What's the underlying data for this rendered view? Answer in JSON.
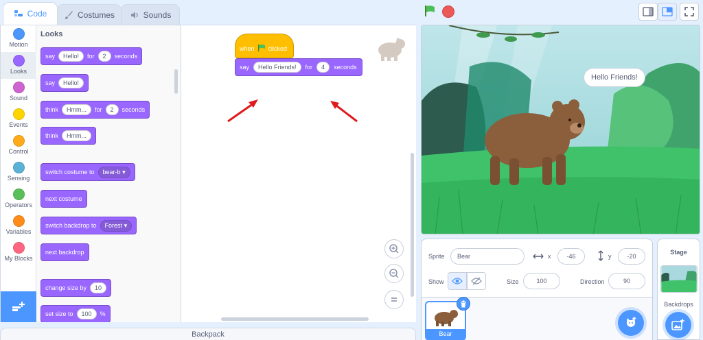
{
  "tabs": {
    "code": "Code",
    "costumes": "Costumes",
    "sounds": "Sounds"
  },
  "categories": [
    {
      "label": "Motion",
      "color": "#4c97ff"
    },
    {
      "label": "Looks",
      "color": "#9966ff"
    },
    {
      "label": "Sound",
      "color": "#cf63cf"
    },
    {
      "label": "Events",
      "color": "#ffd500"
    },
    {
      "label": "Control",
      "color": "#ffab19"
    },
    {
      "label": "Sensing",
      "color": "#5cb1d6"
    },
    {
      "label": "Operators",
      "color": "#59c059"
    },
    {
      "label": "Variables",
      "color": "#ff8c1a"
    },
    {
      "label": "My Blocks",
      "color": "#ff6680"
    }
  ],
  "palette": {
    "title": "Looks",
    "say_for": {
      "say": "say",
      "msg": "Hello!",
      "for": "for",
      "secs": "2",
      "seconds": "seconds"
    },
    "say": {
      "say": "say",
      "msg": "Hello!"
    },
    "think_for": {
      "think": "think",
      "msg": "Hmm...",
      "for": "for",
      "secs": "2",
      "seconds": "seconds"
    },
    "think": {
      "think": "think",
      "msg": "Hmm..."
    },
    "switch_costume": {
      "label": "switch costume to",
      "value": "bear-b"
    },
    "next_costume": "next costume",
    "switch_backdrop": {
      "label": "switch backdrop to",
      "value": "Forest"
    },
    "next_backdrop": "next backdrop",
    "change_size": {
      "label": "change size by",
      "value": "10"
    },
    "set_size": {
      "label": "set size to",
      "value": "100",
      "unit": "%"
    }
  },
  "script": {
    "hat": {
      "when": "when",
      "clicked": "clicked"
    },
    "say": {
      "say": "say",
      "msg": "Hello Friends!",
      "for": "for",
      "secs": "4",
      "seconds": "seconds"
    }
  },
  "backpack": "Backpack",
  "stage": {
    "bubble": "Hello Friends!"
  },
  "sprite_info": {
    "sprite_label": "Sprite",
    "sprite_name": "Bear",
    "x_label": "x",
    "x": "-46",
    "y_label": "y",
    "y": "-20",
    "show_label": "Show",
    "size_label": "Size",
    "size": "100",
    "direction_label": "Direction",
    "direction": "90",
    "thumb_name": "Bear"
  },
  "stage_panel": {
    "title": "Stage",
    "backdrops": "Backdrops"
  }
}
